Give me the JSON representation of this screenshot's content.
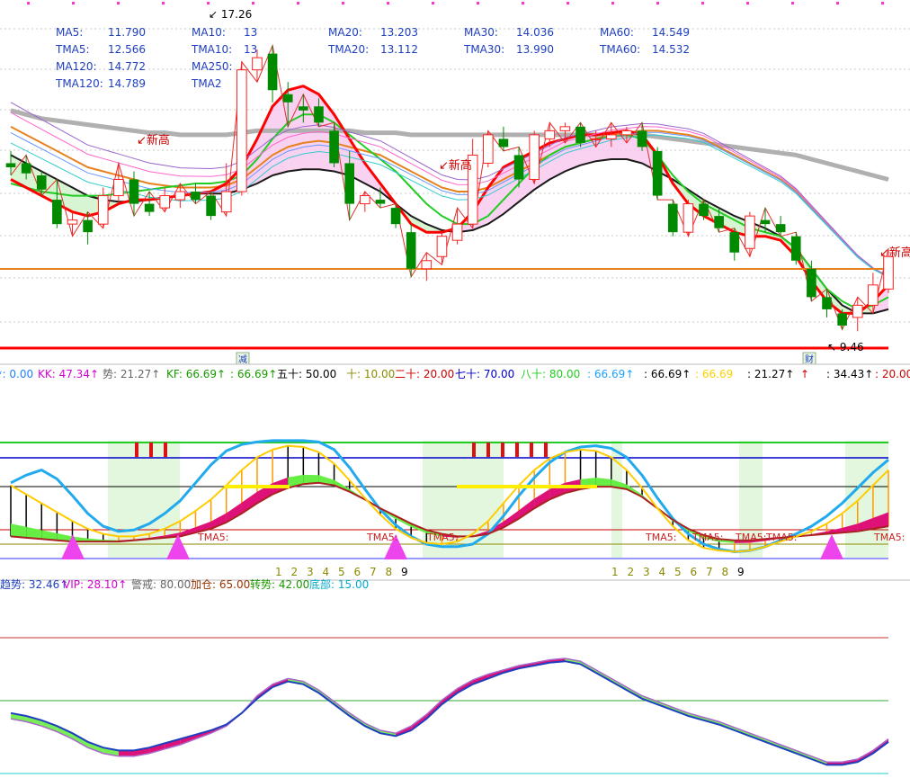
{
  "chart_data": {
    "type": "candlestick-indicator-chart",
    "top_strip": [
      "17.26"
    ],
    "price_labels": {
      "high": "17.26",
      "low": "9.46"
    },
    "ma_panel": [
      {
        "k": "MA5:",
        "v": "11.790",
        "c": "#1f3fbf"
      },
      {
        "k": "MA10:",
        "v": "13",
        "c": "#1f3fbf"
      },
      {
        "k": "MA20:",
        "v": "13.203",
        "c": "#1f3fbf"
      },
      {
        "k": "MA30:",
        "v": "14.036",
        "c": "#1f3fbf"
      },
      {
        "k": "MA60:",
        "v": "14.549",
        "c": "#1f3fbf"
      },
      {
        "k": "TMA5:",
        "v": "12.566",
        "c": "#1f3fbf"
      },
      {
        "k": "TMA10:",
        "v": "13",
        "c": "#1f3fbf"
      },
      {
        "k": "TMA20:",
        "v": "13.112",
        "c": "#1f3fbf"
      },
      {
        "k": "TMA30:",
        "v": "13.990",
        "c": "#1f3fbf"
      },
      {
        "k": "TMA60:",
        "v": "14.532",
        "c": "#1f3fbf"
      },
      {
        "k": "MA120:",
        "v": "14.772",
        "c": "#1f3fbf"
      },
      {
        "k": "MA250:",
        "v": "",
        "c": "#1f3fbf"
      },
      {
        "k": "TMA120:",
        "v": "14.789",
        "c": "#1f3fbf"
      },
      {
        "k": "TMA2",
        "v": "",
        "c": "#1f3fbf"
      }
    ],
    "annotations": [
      "新高",
      "新高",
      "新高"
    ],
    "event_markers": [
      "减",
      "财"
    ],
    "candles": [
      {
        "o": 13.6,
        "h": 13.9,
        "l": 13.3,
        "c": 13.5
      },
      {
        "o": 13.6,
        "h": 13.8,
        "l": 13.2,
        "c": 13.35
      },
      {
        "o": 13.3,
        "h": 13.4,
        "l": 12.8,
        "c": 12.95
      },
      {
        "o": 12.7,
        "h": 13.2,
        "l": 12.0,
        "c": 12.1
      },
      {
        "o": 12.1,
        "h": 12.4,
        "l": 11.8,
        "c": 12.2
      },
      {
        "o": 12.2,
        "h": 12.4,
        "l": 11.6,
        "c": 11.9
      },
      {
        "o": 12.1,
        "h": 13.0,
        "l": 12.0,
        "c": 12.8
      },
      {
        "o": 12.8,
        "h": 13.6,
        "l": 12.6,
        "c": 13.2
      },
      {
        "o": 13.2,
        "h": 13.4,
        "l": 12.3,
        "c": 12.6
      },
      {
        "o": 12.6,
        "h": 12.9,
        "l": 12.3,
        "c": 12.4
      },
      {
        "o": 12.5,
        "h": 13.0,
        "l": 12.4,
        "c": 12.8
      },
      {
        "o": 12.7,
        "h": 13.1,
        "l": 12.5,
        "c": 12.9
      },
      {
        "o": 12.9,
        "h": 13.1,
        "l": 12.6,
        "c": 12.7
      },
      {
        "o": 12.8,
        "h": 12.9,
        "l": 12.2,
        "c": 12.3
      },
      {
        "o": 12.4,
        "h": 13.6,
        "l": 12.3,
        "c": 12.9
      },
      {
        "o": 12.9,
        "h": 16.1,
        "l": 12.8,
        "c": 15.9
      },
      {
        "o": 15.9,
        "h": 16.4,
        "l": 15.6,
        "c": 16.2
      },
      {
        "o": 16.3,
        "h": 16.5,
        "l": 15.1,
        "c": 15.4
      },
      {
        "o": 15.3,
        "h": 15.6,
        "l": 14.5,
        "c": 15.1
      },
      {
        "o": 15.0,
        "h": 15.3,
        "l": 14.6,
        "c": 14.9
      },
      {
        "o": 15.0,
        "h": 15.2,
        "l": 14.5,
        "c": 14.6
      },
      {
        "o": 14.4,
        "h": 14.6,
        "l": 13.5,
        "c": 13.6
      },
      {
        "o": 13.6,
        "h": 13.9,
        "l": 12.2,
        "c": 12.6
      },
      {
        "o": 12.6,
        "h": 12.9,
        "l": 12.4,
        "c": 12.8
      },
      {
        "o": 12.7,
        "h": 13.0,
        "l": 12.5,
        "c": 12.6
      },
      {
        "o": 12.5,
        "h": 12.6,
        "l": 12.0,
        "c": 12.1
      },
      {
        "o": 11.9,
        "h": 12.1,
        "l": 10.8,
        "c": 11.0
      },
      {
        "o": 11.0,
        "h": 11.4,
        "l": 10.7,
        "c": 11.2
      },
      {
        "o": 11.3,
        "h": 11.9,
        "l": 11.1,
        "c": 11.8
      },
      {
        "o": 11.7,
        "h": 12.5,
        "l": 11.6,
        "c": 12.1
      },
      {
        "o": 12.1,
        "h": 14.2,
        "l": 12.0,
        "c": 13.8
      },
      {
        "o": 13.6,
        "h": 14.4,
        "l": 13.5,
        "c": 14.3
      },
      {
        "o": 14.2,
        "h": 14.5,
        "l": 13.9,
        "c": 14.0
      },
      {
        "o": 13.8,
        "h": 14.0,
        "l": 13.0,
        "c": 13.2
      },
      {
        "o": 13.2,
        "h": 14.4,
        "l": 13.1,
        "c": 14.3
      },
      {
        "o": 14.2,
        "h": 14.6,
        "l": 14.0,
        "c": 14.4
      },
      {
        "o": 14.4,
        "h": 14.6,
        "l": 14.1,
        "c": 14.5
      },
      {
        "o": 14.5,
        "h": 14.6,
        "l": 14.0,
        "c": 14.1
      },
      {
        "o": 14.2,
        "h": 14.4,
        "l": 14.0,
        "c": 14.2
      },
      {
        "o": 14.2,
        "h": 14.6,
        "l": 14.0,
        "c": 14.3
      },
      {
        "o": 14.3,
        "h": 14.5,
        "l": 14.1,
        "c": 14.4
      },
      {
        "o": 14.4,
        "h": 14.6,
        "l": 13.9,
        "c": 14.0
      },
      {
        "o": 13.9,
        "h": 14.0,
        "l": 12.7,
        "c": 12.8
      },
      {
        "o": 12.6,
        "h": 12.7,
        "l": 11.8,
        "c": 11.9
      },
      {
        "o": 11.9,
        "h": 12.7,
        "l": 11.8,
        "c": 12.6
      },
      {
        "o": 12.6,
        "h": 12.7,
        "l": 12.2,
        "c": 12.3
      },
      {
        "o": 12.3,
        "h": 12.5,
        "l": 11.9,
        "c": 12.0
      },
      {
        "o": 11.9,
        "h": 12.0,
        "l": 11.2,
        "c": 11.4
      },
      {
        "o": 11.5,
        "h": 12.4,
        "l": 11.3,
        "c": 12.3
      },
      {
        "o": 12.2,
        "h": 12.5,
        "l": 11.9,
        "c": 12.1
      },
      {
        "o": 12.1,
        "h": 12.3,
        "l": 11.8,
        "c": 11.9
      },
      {
        "o": 11.8,
        "h": 11.9,
        "l": 11.1,
        "c": 11.2
      },
      {
        "o": 11.0,
        "h": 11.2,
        "l": 10.2,
        "c": 10.3
      },
      {
        "o": 10.3,
        "h": 10.5,
        "l": 9.8,
        "c": 10.0
      },
      {
        "o": 9.9,
        "h": 10.0,
        "l": 9.5,
        "c": 9.6
      },
      {
        "o": 9.8,
        "h": 10.3,
        "l": 9.46,
        "c": 10.1
      },
      {
        "o": 10.1,
        "h": 10.9,
        "l": 9.9,
        "c": 10.6
      },
      {
        "o": 10.5,
        "h": 11.5,
        "l": 10.4,
        "c": 11.3
      }
    ],
    "overlay_lines": [
      {
        "color": "#b0b0b0",
        "width": 5,
        "v": [
          14.9,
          14.8,
          14.7,
          14.65,
          14.6,
          14.55,
          14.5,
          14.45,
          14.4,
          14.35,
          14.35,
          14.3,
          14.3,
          14.3,
          14.3,
          14.35,
          14.4,
          14.4,
          14.4,
          14.4,
          14.4,
          14.4,
          14.4,
          14.35,
          14.35,
          14.35,
          14.3,
          14.3,
          14.3,
          14.3,
          14.3,
          14.3,
          14.3,
          14.3,
          14.3,
          14.3,
          14.3,
          14.3,
          14.3,
          14.3,
          14.3,
          14.3,
          14.25,
          14.2,
          14.15,
          14.1,
          14.05,
          14.0,
          13.95,
          13.9,
          13.85,
          13.8,
          13.7,
          13.6,
          13.5,
          13.4,
          13.3,
          13.2
        ]
      },
      {
        "color": "#e6821e",
        "width": 2,
        "v": [
          14.5,
          14.3,
          14.1,
          13.9,
          13.7,
          13.5,
          13.4,
          13.3,
          13.2,
          13.1,
          13.05,
          13.0,
          13.0,
          13.0,
          13.05,
          13.2,
          13.5,
          13.8,
          14.0,
          14.1,
          14.15,
          14.1,
          14.0,
          13.9,
          13.8,
          13.6,
          13.4,
          13.2,
          13.0,
          12.9,
          12.9,
          13.0,
          13.2,
          13.4,
          13.6,
          13.8,
          14.0,
          14.1,
          14.2,
          14.3,
          14.35,
          14.4,
          14.4,
          14.35,
          14.3,
          14.2,
          14.0,
          13.8,
          13.6,
          13.4,
          13.2,
          12.9,
          12.5,
          12.1,
          11.7,
          11.3,
          11.0,
          10.8
        ]
      },
      {
        "color": "#1a1a1a",
        "width": 2,
        "v": [
          13.8,
          13.6,
          13.4,
          13.2,
          13.0,
          12.8,
          12.7,
          12.65,
          12.65,
          12.7,
          12.75,
          12.8,
          12.85,
          12.85,
          12.85,
          12.95,
          13.1,
          13.3,
          13.4,
          13.45,
          13.45,
          13.4,
          13.3,
          13.1,
          12.9,
          12.6,
          12.3,
          12.1,
          11.95,
          11.9,
          11.95,
          12.1,
          12.35,
          12.65,
          12.95,
          13.2,
          13.4,
          13.55,
          13.65,
          13.7,
          13.7,
          13.6,
          13.4,
          13.2,
          12.95,
          12.7,
          12.5,
          12.3,
          12.15,
          12.0,
          11.8,
          11.5,
          11.0,
          10.5,
          10.1,
          9.9,
          9.9,
          10.0
        ]
      },
      {
        "color": "#22cc22",
        "width": 2,
        "v": [
          13.1,
          13.0,
          12.9,
          12.85,
          12.8,
          12.8,
          12.8,
          12.85,
          12.9,
          12.95,
          13.0,
          13.05,
          13.1,
          13.1,
          13.15,
          13.3,
          13.7,
          14.2,
          14.6,
          14.8,
          14.8,
          14.6,
          14.3,
          14.0,
          13.7,
          13.4,
          13.0,
          12.6,
          12.3,
          12.1,
          12.1,
          12.3,
          12.7,
          13.1,
          13.5,
          13.8,
          14.0,
          14.1,
          14.2,
          14.25,
          14.3,
          14.2,
          13.8,
          13.3,
          12.9,
          12.6,
          12.4,
          12.2,
          12.0,
          11.9,
          11.8,
          11.5,
          11.0,
          10.5,
          10.2,
          10.0,
          10.1,
          10.3
        ]
      },
      {
        "color": "#ff0000",
        "width": 3,
        "v": [
          13.2,
          13.0,
          12.8,
          12.6,
          12.4,
          12.3,
          12.4,
          12.6,
          12.7,
          12.7,
          12.75,
          12.8,
          12.85,
          12.9,
          13.1,
          13.5,
          14.2,
          15.0,
          15.4,
          15.5,
          15.3,
          14.8,
          14.2,
          13.6,
          13.1,
          12.6,
          12.1,
          11.9,
          11.9,
          12.0,
          12.4,
          13.0,
          13.5,
          13.7,
          13.9,
          14.1,
          14.2,
          14.3,
          14.3,
          14.35,
          14.4,
          14.3,
          13.8,
          13.1,
          12.6,
          12.3,
          12.1,
          11.9,
          11.8,
          11.8,
          11.7,
          11.3,
          10.7,
          10.2,
          9.9,
          9.9,
          10.2,
          10.6
        ]
      }
    ],
    "indicator1": {
      "labels": [
        {
          "t": "ʶ: 0.00",
          "c": "#1f7fff"
        },
        {
          "t": "KK: 47.34↑",
          "c": "#d400d4"
        },
        {
          "t": "势: 21.27↑",
          "c": "#666666"
        },
        {
          "t": "KF: 66.69↑",
          "c": "#1a9900"
        },
        {
          "t": ": 66.69↑",
          "c": "#1a9900"
        },
        {
          "t": "五十: 50.00",
          "c": "#000000"
        },
        {
          "t": "十: 10.00",
          "c": "#8a8a00"
        },
        {
          "t": "二十: 20.00",
          "c": "#cc0000"
        },
        {
          "t": "七十: 70.00",
          "c": "#0000cc"
        },
        {
          "t": "八十: 80.00",
          "c": "#22cc22"
        },
        {
          "t": ": 66.69↑",
          "c": "#1fa0ff"
        },
        {
          "t": ": 66.69↑",
          "c": "#000000"
        },
        {
          "t": ": 66.69",
          "c": "#ffd000"
        },
        {
          "t": ": 21.27↑",
          "c": "#000000"
        },
        {
          "t": "↑",
          "c": "#cc0000"
        },
        {
          "t": ": 34.43↑",
          "c": "#000000"
        },
        {
          "t": ": 20.00",
          "c": "#cc0000"
        }
      ],
      "marker_text": "TMA5:",
      "count_labels": [
        "1",
        "2",
        "3",
        "4",
        "5",
        "6",
        "7",
        "8",
        "9"
      ],
      "fast": [
        58,
        51,
        44,
        37,
        30,
        24,
        20,
        18,
        18,
        20,
        24,
        30,
        38,
        47,
        58,
        70,
        80,
        86,
        89,
        88,
        84,
        75,
        62,
        48,
        35,
        24,
        17,
        13,
        12,
        14,
        20,
        30,
        44,
        58,
        70,
        79,
        84,
        86,
        85,
        80,
        70,
        56,
        40,
        26,
        15,
        9,
        7,
        6,
        7,
        10,
        14,
        18,
        22,
        28,
        36,
        46,
        58,
        70
      ],
      "slow": [
        18,
        17,
        16,
        15,
        14,
        14,
        14,
        14,
        15,
        16,
        17,
        18,
        21,
        24,
        29,
        36,
        44,
        51,
        56,
        59,
        60,
        58,
        53,
        47,
        40,
        34,
        28,
        23,
        20,
        18,
        18,
        20,
        25,
        32,
        40,
        47,
        52,
        55,
        57,
        57,
        55,
        49,
        40,
        31,
        24,
        19,
        16,
        15,
        15,
        16,
        17,
        18,
        19,
        20,
        21,
        22,
        24,
        26
      ],
      "blue": [
        60,
        66,
        70,
        63,
        50,
        36,
        26,
        22,
        23,
        28,
        36,
        46,
        60,
        74,
        85,
        90,
        92,
        93,
        93,
        93,
        92,
        86,
        72,
        55,
        39,
        27,
        18,
        12,
        10,
        10,
        12,
        20,
        34,
        50,
        64,
        76,
        84,
        88,
        89,
        87,
        80,
        66,
        48,
        32,
        20,
        12,
        8,
        6,
        7,
        10,
        15,
        20,
        26,
        34,
        44,
        56,
        68,
        78
      ]
    },
    "indicator2": {
      "labels": [
        {
          "t": "趋势: 32.46↑",
          "c": "#1f3fbf"
        },
        {
          "t": "VIP: 28.10↑",
          "c": "#d400d4"
        },
        {
          "t": "警戒: 80.00",
          "c": "#666666"
        },
        {
          "t": "加仓: 65.00",
          "c": "#993300"
        },
        {
          "t": "转势: 42.00",
          "c": "#1a9900"
        },
        {
          "t": "底部: 15.00",
          "c": "#00aacc"
        }
      ],
      "trend": [
        42,
        40,
        37,
        33,
        28,
        22,
        18,
        16,
        16,
        18,
        21,
        24,
        27,
        30,
        34,
        42,
        52,
        60,
        64,
        62,
        56,
        48,
        40,
        33,
        28,
        26,
        30,
        38,
        48,
        56,
        62,
        66,
        70,
        73,
        75,
        77,
        78,
        76,
        70,
        64,
        58,
        52,
        48,
        44,
        40,
        37,
        34,
        30,
        26,
        22,
        18,
        14,
        10,
        6,
        6,
        8,
        14,
        22
      ],
      "vip": [
        38,
        36,
        33,
        29,
        24,
        18,
        14,
        12,
        12,
        14,
        17,
        20,
        24,
        28,
        33,
        42,
        54,
        62,
        66,
        64,
        58,
        50,
        42,
        35,
        30,
        28,
        33,
        41,
        51,
        59,
        65,
        69,
        72,
        75,
        77,
        79,
        80,
        78,
        72,
        66,
        60,
        54,
        50,
        46,
        42,
        39,
        36,
        32,
        28,
        24,
        20,
        16,
        12,
        8,
        8,
        10,
        16,
        24
      ]
    }
  }
}
